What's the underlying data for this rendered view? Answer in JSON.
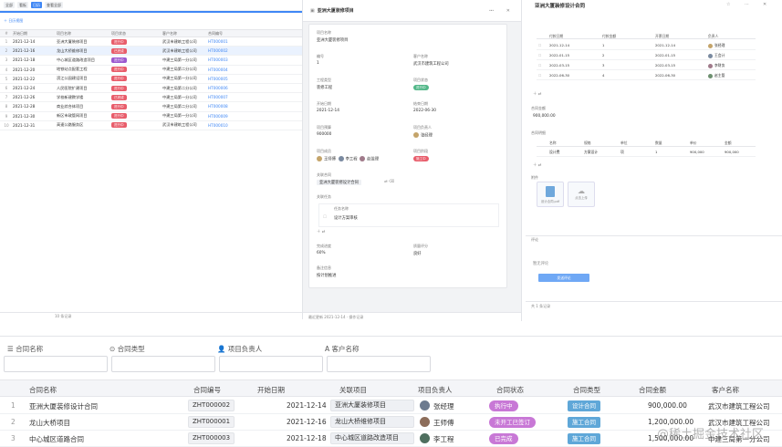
{
  "left_panel": {
    "toolbar": [
      "全部",
      "看板",
      "日历",
      "查看全部"
    ],
    "sub_toolbar": "日历视图",
    "columns": [
      "开始日期",
      "项目名称",
      "项目状态",
      "客户名称",
      "合同编号"
    ],
    "rows": [
      {
        "n": "1",
        "date": "2021-12-14",
        "name": "亚洲大厦装修项目",
        "status": "进行中",
        "client": "武汉市建筑工程公司",
        "link": "HT000001"
      },
      {
        "n": "2",
        "date": "2021-12-16",
        "name": "龙山大桥维修项目",
        "status": "已完成",
        "client": "武汉市建筑工程公司",
        "link": "HT000002"
      },
      {
        "n": "3",
        "date": "2021-12-18",
        "name": "中心城区道路改造项目",
        "status": "进行中",
        "client": "中建三局第一分公司",
        "link": "HT000003"
      },
      {
        "n": "4",
        "date": "2021-12-20",
        "name": "地铁站点配套工程",
        "status": "进行中",
        "client": "中建三局第二分公司",
        "link": "HT000004"
      },
      {
        "n": "5",
        "date": "2021-12-22",
        "name": "滨江公园建设项目",
        "status": "进行中",
        "client": "中建三局第一分公司",
        "link": "HT000005"
      },
      {
        "n": "6",
        "date": "2021-12-24",
        "name": "人民医院扩建项目",
        "status": "进行中",
        "client": "中建三局第二分公司",
        "link": "HT000006"
      },
      {
        "n": "7",
        "date": "2021-12-26",
        "name": "学校新建教学楼",
        "status": "已完成",
        "client": "中建三局第一分公司",
        "link": "HT000007"
      },
      {
        "n": "8",
        "date": "2021-12-28",
        "name": "商业综合体项目",
        "status": "进行中",
        "client": "中建三局第二分公司",
        "link": "HT000008"
      },
      {
        "n": "9",
        "date": "2021-12-30",
        "name": "新区市政管网项目",
        "status": "进行中",
        "client": "中建三局第一分公司",
        "link": "HT000009"
      },
      {
        "n": "10",
        "date": "2021-12-31",
        "name": "高速公路服务区",
        "status": "进行中",
        "client": "武汉市建筑工程公司",
        "link": "HT000010"
      }
    ],
    "footer": "10 条记录"
  },
  "middle_panel": {
    "title": "亚洲大厦装修项目",
    "project_name_label": "项目名称",
    "project_name": "亚洲大厦装修项目",
    "code_label": "编号",
    "code": "1",
    "client_label": "客户名称",
    "client": "武汉市建筑工程公司",
    "type_label": "工程类型",
    "type": "装修工程",
    "status_label": "项目状态",
    "status": "进行中",
    "start_label": "开始日期",
    "start": "2021-12-14",
    "end_label": "结束日期",
    "end": "2022-06-30",
    "budget_label": "项目预算",
    "budget": "900000",
    "manager_label": "项目负责人",
    "manager": "张经理",
    "members_label": "项目成员",
    "members": [
      "王师傅",
      "李工程",
      "赵监理"
    ],
    "phase_label": "项目阶段",
    "phase": "施工中",
    "contract_label": "关联合同",
    "contract": "亚洲大厦装修设计合同",
    "tasks_label": "关联任务",
    "tasks_col": "任务名称",
    "task": "设计方案审核",
    "progress_label": "完成进度",
    "progress": "60%",
    "quality_label": "质量评分",
    "quality": "良好",
    "note_label": "备注信息",
    "note": "按计划推进",
    "footer": "最近更新 2021-12-14 · 操作记录"
  },
  "right_panel": {
    "title": "亚洲大厦装修设计合同",
    "grid_header": [
      "付款日期",
      "付款金额",
      "开票日期",
      "负责人"
    ],
    "grid_rows": [
      {
        "date": "2021-12-14",
        "amt": "1",
        "inv": "2021-12-14",
        "person": "张经理"
      },
      {
        "date": "2022-01-15",
        "amt": "2",
        "inv": "2022-01-15",
        "person": "王会计"
      },
      {
        "date": "2022-03-15",
        "amt": "3",
        "inv": "2022-03-15",
        "person": "李财务"
      },
      {
        "date": "2022-06-30",
        "amt": "4",
        "inv": "2022-06-30",
        "person": "赵主管"
      }
    ],
    "amount_label": "合同金额",
    "amount": "900,000.00",
    "items_label": "合同明细",
    "items_header": [
      "名称",
      "规格",
      "单位",
      "数量",
      "单价",
      "金额"
    ],
    "items_row": [
      "设计费",
      "方案设计",
      "项",
      "1",
      "900,000",
      "900,000"
    ],
    "files_label": "附件",
    "file1": "设计合同.pdf",
    "file2": "点击上传",
    "comment_label": "评论",
    "comment": "暂无评论",
    "comment_btn": "发送评论",
    "footer": "共 1 条记录"
  },
  "bottom": {
    "filters": [
      "合同名称",
      "合同类型",
      "项目负责人",
      "客户名称"
    ],
    "columns": [
      "合同名称",
      "合同编号",
      "开始日期",
      "关联项目",
      "项目负责人",
      "合同状态",
      "合同类型",
      "合同金额",
      "客户名称"
    ],
    "rows": [
      {
        "n": "1",
        "name": "亚洲大厦装修设计合同",
        "code": "ZHT000002",
        "date": "2021-12-14",
        "proj": "亚洲大厦装修项目",
        "person": "张经理",
        "status": "执行中",
        "type": "设计合同",
        "amt": "900,000.00",
        "client": "武汉市建筑工程公司"
      },
      {
        "n": "2",
        "name": "龙山大桥项目",
        "code": "ZHT000001",
        "date": "2021-12-16",
        "proj": "龙山大桥维修项目",
        "person": "王师傅",
        "status": "未开工已签订",
        "type": "施工合同",
        "amt": "1,200,000.00",
        "client": "武汉市建筑工程公司"
      },
      {
        "n": "3",
        "name": "中心城区道路合同",
        "code": "ZHT000003",
        "date": "2021-12-18",
        "proj": "中心城区道路改造项目",
        "person": "李工程",
        "status": "已完成",
        "type": "施工合同",
        "amt": "1,500,000.00",
        "client": "中建三局第一分公司"
      }
    ],
    "watermark": "@稀土掘金技术社区"
  }
}
